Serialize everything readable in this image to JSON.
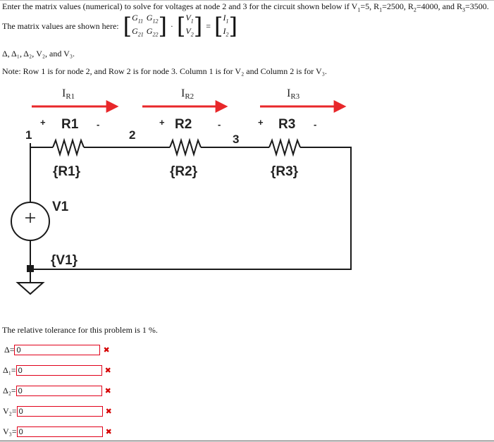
{
  "question": {
    "intro_prefix": "Enter the matrix values (numerical) to solve for voltages at node 2 and 3 for the circuit shown below if V",
    "intro_rest": "=5, R",
    "intro_r1": "=2500, R",
    "intro_r2": "=4000, and R",
    "intro_r3": "=3500.",
    "matrix_label": "The matrix values are shown here:",
    "matrix": {
      "g11": "G",
      "g11s": "11",
      "g12": "G",
      "g12s": "12",
      "g21": "G",
      "g21s": "21",
      "g22": "G",
      "g22s": "22",
      "v1": "V",
      "v1s": "1",
      "v2": "V",
      "v2s": "2",
      "i1": "I",
      "i1s": "1",
      "i2": "I",
      "i2s": "2",
      "dot": "·",
      "eq": "="
    },
    "unknowns_line": "Δ, Δ₁, Δ₂, V₂, and V₃.",
    "note": "Note: Row 1 is for node 2, and Row 2 is for node 3.  Column 1 is for V₂ and Column 2 is for V₃.",
    "tolerance": "The relative tolerance for this problem is 1 %."
  },
  "circuit": {
    "currents": [
      "I",
      "I",
      "I"
    ],
    "current_subs": [
      "R1",
      "R2",
      "R3"
    ],
    "resistor_names": [
      "R1",
      "R2",
      "R3"
    ],
    "resistor_values": [
      "{R1}",
      "{R2}",
      "{R3}"
    ],
    "nodes": [
      "1",
      "2",
      "3"
    ],
    "plus": "+",
    "minus": "-",
    "source_name": "V1",
    "source_value": "{V1}",
    "colors": {
      "arrow": "#e8272a",
      "wire": "#1a1a1a"
    }
  },
  "answers": [
    {
      "label": "Δ=",
      "value": "0"
    },
    {
      "label": "Δ₁=",
      "value": "0"
    },
    {
      "label": "Δ₂=",
      "value": "0"
    },
    {
      "label": "V₂=",
      "value": "0"
    },
    {
      "label": "V₃=",
      "value": "0"
    }
  ],
  "marks": {
    "incorrect": "✖"
  }
}
